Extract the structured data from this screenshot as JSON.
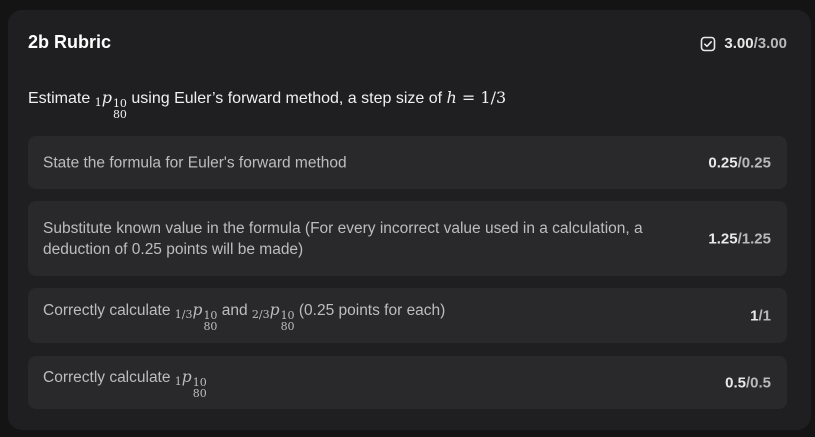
{
  "rubric": {
    "title": "2b Rubric",
    "earned": "3.00",
    "max": "/3.00",
    "status_icon": "check-square-icon"
  },
  "question": {
    "prefix": "Estimate ",
    "p_sub_pre": "1",
    "p_sup": "10",
    "p_sub": "80",
    "middle": " using Euler’s forward method, a step size of ",
    "h_var": "h",
    "h_eq": " = 1/3"
  },
  "criteria": [
    {
      "text": "State the formula for Euler's forward method",
      "earned": "0.25",
      "max": "/0.25"
    },
    {
      "text": "Substitute known value in the formula (For every incorrect value used in a calculation, a deduction of 0.25 points will be made)",
      "earned": "1.25",
      "max": "/1.25"
    },
    {
      "prefix": "Correctly calculate ",
      "a_sub_pre": "1/3",
      "a_sup": "10",
      "a_sub": "80",
      "mid": " and ",
      "b_sub_pre": "2/3",
      "b_sup": "10",
      "b_sub": "80",
      "suffix": " (0.25 points for each)",
      "earned": "1",
      "max": "/1"
    },
    {
      "prefix": "Correctly calculate ",
      "c_sub_pre": "1",
      "c_sup": "10",
      "c_sub": "80",
      "earned": "0.5",
      "max": "/0.5"
    }
  ]
}
